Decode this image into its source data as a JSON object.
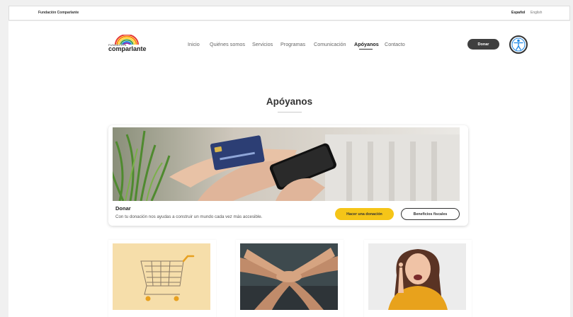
{
  "topbar": {
    "org_name": "Fundación Comparlante",
    "lang_es": "Español",
    "lang_en": "English"
  },
  "logo": {
    "small": "FUNDACIÓN",
    "big": "comparlante"
  },
  "nav": [
    "Inicio",
    "Quiénes somos",
    "Servicios",
    "Programas",
    "Comunicación",
    "Apóyanos",
    "Contacto"
  ],
  "nav_active": "Apóyanos",
  "header_button": "Donar",
  "page_title": "Apóyanos",
  "donate_card": {
    "heading": "Donar",
    "description": "Con tu donación nos ayudas a construir un mundo cada vez más accesible.",
    "primary_button": "Hacer una donación",
    "secondary_button": "Beneficios fiscales"
  },
  "colors": {
    "accent_yellow": "#f5c518",
    "dark_button": "#3f3f3f",
    "rainbow": [
      "#e53935",
      "#fb8c00",
      "#fdd835",
      "#43a047",
      "#1e88e5",
      "#8e24aa"
    ]
  },
  "icons": {
    "accessibility": "accessibility-icon"
  }
}
